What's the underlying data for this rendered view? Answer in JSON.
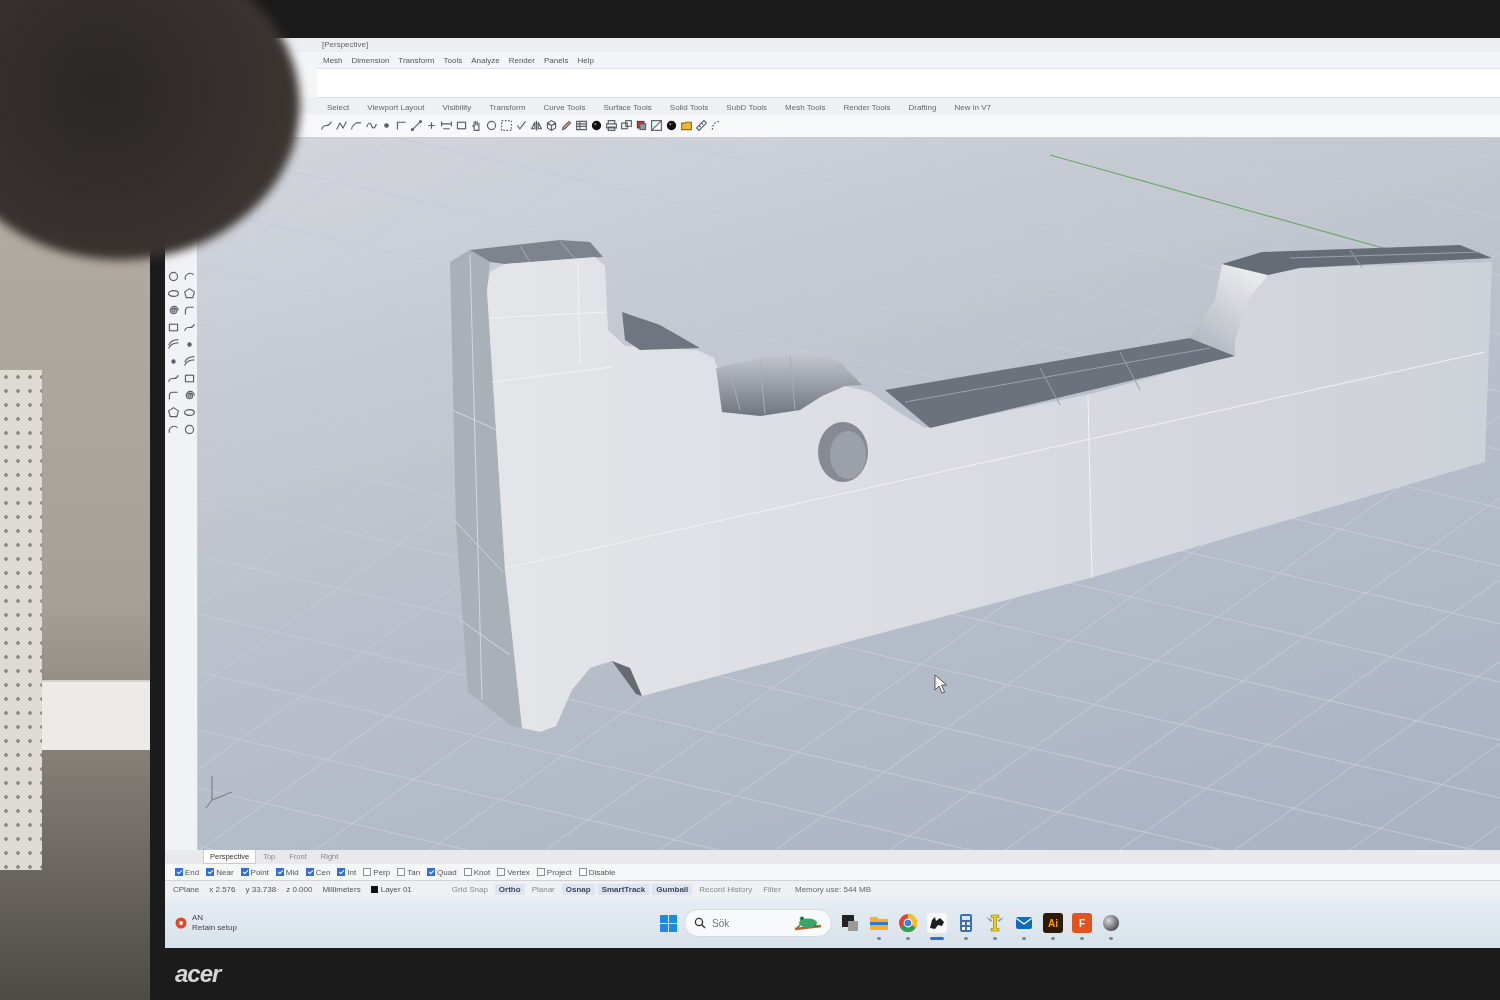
{
  "window": {
    "title": "[Perspective]"
  },
  "menu": [
    "Mesh",
    "Dimension",
    "Transform",
    "Tools",
    "Analyze",
    "Render",
    "Panels",
    "Help"
  ],
  "toolbar_tabs": [
    {
      "label": "Select",
      "selected": false
    },
    {
      "label": "Viewport Layout",
      "selected": false
    },
    {
      "label": "Visibility",
      "selected": false
    },
    {
      "label": "Transform",
      "selected": false
    },
    {
      "label": "Curve Tools",
      "selected": false
    },
    {
      "label": "Surface Tools",
      "selected": false
    },
    {
      "label": "Solid Tools",
      "selected": false
    },
    {
      "label": "SubD Tools",
      "selected": false
    },
    {
      "label": "Mesh Tools",
      "selected": false
    },
    {
      "label": "Render Tools",
      "selected": false
    },
    {
      "label": "Drafting",
      "selected": false
    },
    {
      "label": "New in V7",
      "selected": false
    }
  ],
  "viewport_tabs": [
    {
      "label": "Perspective",
      "selected": true
    },
    {
      "label": "Top",
      "selected": false
    },
    {
      "label": "Front",
      "selected": false
    },
    {
      "label": "Right",
      "selected": false
    }
  ],
  "osnaps": [
    {
      "label": "End",
      "checked": true
    },
    {
      "label": "Near",
      "checked": true
    },
    {
      "label": "Point",
      "checked": true
    },
    {
      "label": "Mid",
      "checked": true
    },
    {
      "label": "Cen",
      "checked": true
    },
    {
      "label": "Int",
      "checked": true
    },
    {
      "label": "Perp",
      "checked": false
    },
    {
      "label": "Tan",
      "checked": false
    },
    {
      "label": "Quad",
      "checked": true
    },
    {
      "label": "Knot",
      "checked": false
    },
    {
      "label": "Vertex",
      "checked": false
    },
    {
      "label": "Project",
      "checked": false
    },
    {
      "label": "Disable",
      "checked": false
    }
  ],
  "status": {
    "cplane": "CPlane",
    "x": "x 2.576",
    "y": "y 33.738",
    "z": "z 0.000",
    "units": "Millimeters",
    "layer": "Layer 01",
    "toggles": [
      {
        "label": "Grid Snap",
        "on": false
      },
      {
        "label": "Ortho",
        "on": true
      },
      {
        "label": "Planar",
        "on": false
      },
      {
        "label": "Osnap",
        "on": true
      },
      {
        "label": "SmartTrack",
        "on": true
      },
      {
        "label": "Gumball",
        "on": true
      },
      {
        "label": "Record History",
        "on": false
      },
      {
        "label": "Filter",
        "on": false
      }
    ],
    "memory": "Memory use: 544 MB"
  },
  "taskbar": {
    "widget": {
      "title": "AN",
      "subtitle": "Retain setup"
    },
    "search": {
      "placeholder": "Sök"
    },
    "apps": [
      {
        "kind": "window",
        "running": false,
        "active": false
      },
      {
        "kind": "folder",
        "running": true,
        "active": false
      },
      {
        "kind": "browser",
        "running": true,
        "active": false
      },
      {
        "kind": "cad",
        "running": true,
        "active": true
      },
      {
        "kind": "calculator",
        "running": true,
        "active": false
      },
      {
        "kind": "trophy",
        "running": true,
        "active": false
      },
      {
        "kind": "mail",
        "running": true,
        "active": false
      },
      {
        "kind": "tile",
        "label": "Ai",
        "color": "#2e1b06",
        "running": true,
        "active": false
      },
      {
        "kind": "tile",
        "label": "F",
        "color": "#e4531d",
        "running": true,
        "active": false
      },
      {
        "kind": "orb",
        "running": true,
        "active": false
      }
    ]
  },
  "monitor": {
    "brand": "acer"
  }
}
